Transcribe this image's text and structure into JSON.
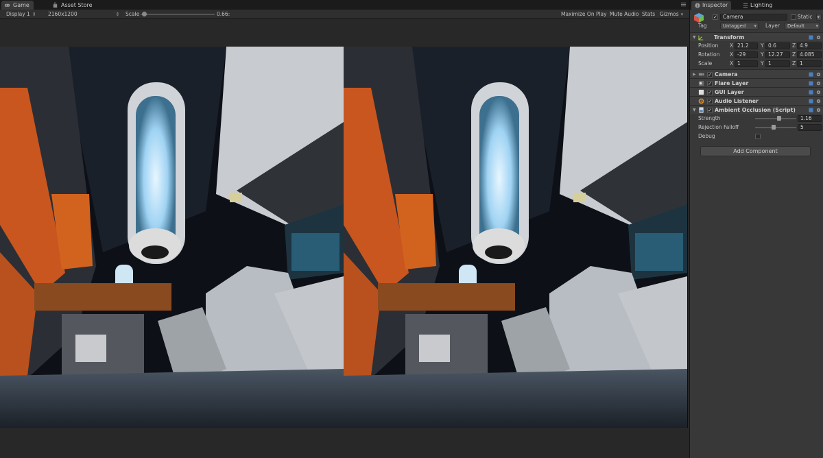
{
  "game_panel": {
    "tabs": [
      {
        "label": "Game",
        "icon": "game-controller-icon",
        "active": true
      },
      {
        "label": "Asset Store",
        "icon": "shopping-bag-icon",
        "active": false
      }
    ],
    "toolbar": {
      "display": "Display 1",
      "resolution": "2160x1200",
      "scale_label": "Scale",
      "scale_value": "0.66:",
      "scale_level": 0.02,
      "maximize_on_play": "Maximize On Play",
      "mute_audio": "Mute Audio",
      "stats": "Stats",
      "gizmos": "Gizmos"
    },
    "viewport": {
      "mode": "stereo side-by-side"
    }
  },
  "inspector": {
    "tabs": [
      {
        "label": "Inspector",
        "icon": "info-icon",
        "active": true
      },
      {
        "label": "Lighting",
        "icon": "lighting-icon",
        "active": false
      }
    ],
    "object": {
      "name": "Camera",
      "static_label": "Static",
      "tag_label": "Tag",
      "tag_value": "Untagged",
      "layer_label": "Layer",
      "layer_value": "Default"
    },
    "transform": {
      "title": "Transform",
      "position": {
        "label": "Position",
        "x": "21.2",
        "y": "0.6",
        "z": "4.9"
      },
      "rotation": {
        "label": "Rotation",
        "x": "-29",
        "y": "12.27",
        "z": "4.085"
      },
      "scale": {
        "label": "Scale",
        "x": "1",
        "y": "1",
        "z": "1"
      }
    },
    "components": [
      {
        "title": "Camera",
        "icon": "camera-icon"
      },
      {
        "title": "Flare Layer",
        "icon": "flare-icon"
      },
      {
        "title": "GUI Layer",
        "icon": "gui-icon"
      },
      {
        "title": "Audio Listener",
        "icon": "audio-listener-icon"
      },
      {
        "title": "Ambient Occlusion (Script)",
        "icon": "script-icon"
      }
    ],
    "ambient_occlusion": {
      "strength_label": "Strength",
      "strength_value": "1.16",
      "strength_level": 0.58,
      "rejection_label": "Rejection Falloff",
      "rejection_value": "5",
      "rejection_level": 0.45,
      "debug_label": "Debug"
    },
    "add_component": "Add Component"
  },
  "colors": {
    "accent_orange": "#d0561c",
    "panel_dark": "#383838"
  }
}
